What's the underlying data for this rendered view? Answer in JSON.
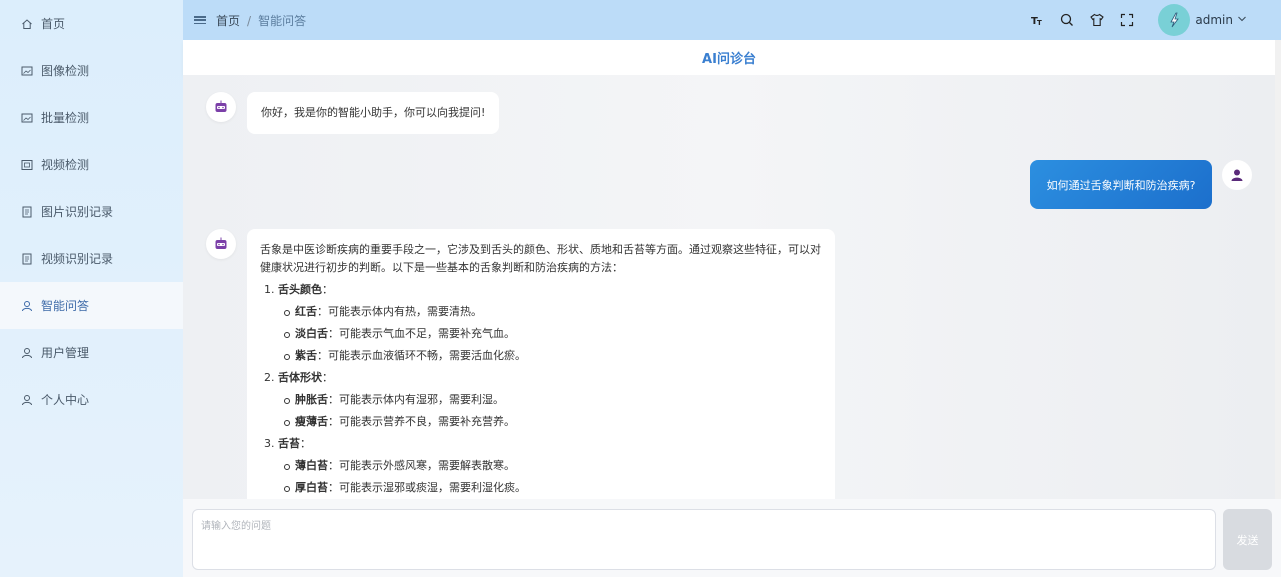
{
  "sidebar": {
    "items": [
      {
        "label": "首页",
        "icon": "home-icon"
      },
      {
        "label": "图像检测",
        "icon": "image-icon"
      },
      {
        "label": "批量检测",
        "icon": "image-icon"
      },
      {
        "label": "视频检测",
        "icon": "video-icon"
      },
      {
        "label": "图片识别记录",
        "icon": "record-icon"
      },
      {
        "label": "视频识别记录",
        "icon": "record-icon"
      },
      {
        "label": "智能问答",
        "icon": "user-icon",
        "active": true
      },
      {
        "label": "用户管理",
        "icon": "user-icon"
      },
      {
        "label": "个人中心",
        "icon": "user-icon"
      }
    ]
  },
  "header": {
    "breadcrumb": {
      "home": "首页",
      "separator": "/",
      "current": "智能问答"
    },
    "username": "admin"
  },
  "page": {
    "title": "AI问诊台"
  },
  "chat": {
    "greeting": "你好，我是你的智能小助手，你可以向我提问!",
    "question": "如何通过舌象判断和防治疾病?",
    "answer": {
      "intro": "舌象是中医诊断疾病的重要手段之一，它涉及到舌头的颜色、形状、质地和舌苔等方面。通过观察这些特征，可以对健康状况进行初步的判断。以下是一些基本的舌象判断和防治疾病的方法：",
      "sections": [
        {
          "title": "舌头颜色",
          "items": [
            {
              "term": "红舌",
              "desc": "：可能表示体内有热，需要清热。"
            },
            {
              "term": "淡白舌",
              "desc": "：可能表示气血不足，需要补充气血。"
            },
            {
              "term": "紫舌",
              "desc": "：可能表示血液循环不畅，需要活血化瘀。"
            }
          ]
        },
        {
          "title": "舌体形状",
          "items": [
            {
              "term": "肿胀舌",
              "desc": "：可能表示体内有湿邪，需要利湿。"
            },
            {
              "term": "瘦薄舌",
              "desc": "：可能表示营养不良，需要补充营养。"
            }
          ]
        },
        {
          "title": "舌苔",
          "items": [
            {
              "term": "薄白苔",
              "desc": "：可能表示外感风寒，需要解表散寒。"
            },
            {
              "term": "厚白苔",
              "desc": "：可能表示湿邪或痰湿，需要利湿化痰。"
            }
          ]
        }
      ]
    }
  },
  "input": {
    "placeholder": "请输入您的问题",
    "send_label": "发送"
  },
  "colors": {
    "accent": "#3a7fd0",
    "header_bg": "#bcdcf8",
    "user_bubble": "#1c6fcc"
  }
}
